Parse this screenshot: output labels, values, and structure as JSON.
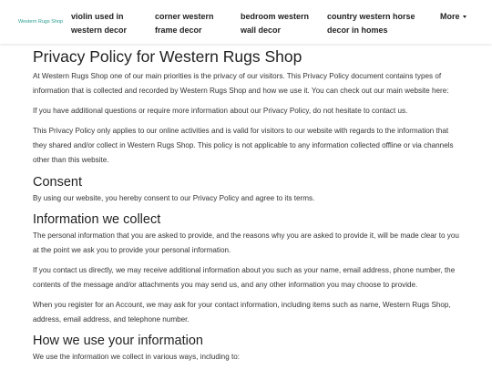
{
  "nav": {
    "brand": "Western Rugs Shop",
    "items": [
      "violin used in western decor",
      "corner western frame decor",
      "bedroom western wall decor",
      "country western horse decor in homes"
    ],
    "more": "More"
  },
  "page": {
    "title": "Privacy Policy for Western Rugs Shop",
    "intro_p1": "At Western Rugs Shop one of our main priorities is the privacy of our visitors. This Privacy Policy document contains types of information that is collected and recorded by Western Rugs Shop and how we use it. You can check out our main website here:",
    "intro_p2": "If you have additional questions or require more information about our Privacy Policy, do not hesitate to contact us.",
    "intro_p3": "This Privacy Policy only applies to our online activities and is valid for visitors to our website with regards to the information that they shared and/or collect in Western Rugs Shop. This policy is not applicable to any information collected offline or via channels other than this website.",
    "consent_heading": "Consent",
    "consent_p": "By using our website, you hereby consent to our Privacy Policy and agree to its terms.",
    "collect_heading": "Information we collect",
    "collect_p1": "The personal information that you are asked to provide, and the reasons why you are asked to provide it, will be made clear to you at the point we ask you to provide your personal information.",
    "collect_p2": "If you contact us directly, we may receive additional information about you such as your name, email address, phone number, the contents of the message and/or attachments you may send us, and any other information you may choose to provide.",
    "collect_p3": "When you register for an Account, we may ask for your contact information, including items such as name, Western Rugs Shop, address, email address, and telephone number.",
    "use_heading": "How we use your information",
    "use_p1": "We use the information we collect in various ways, including to:"
  }
}
